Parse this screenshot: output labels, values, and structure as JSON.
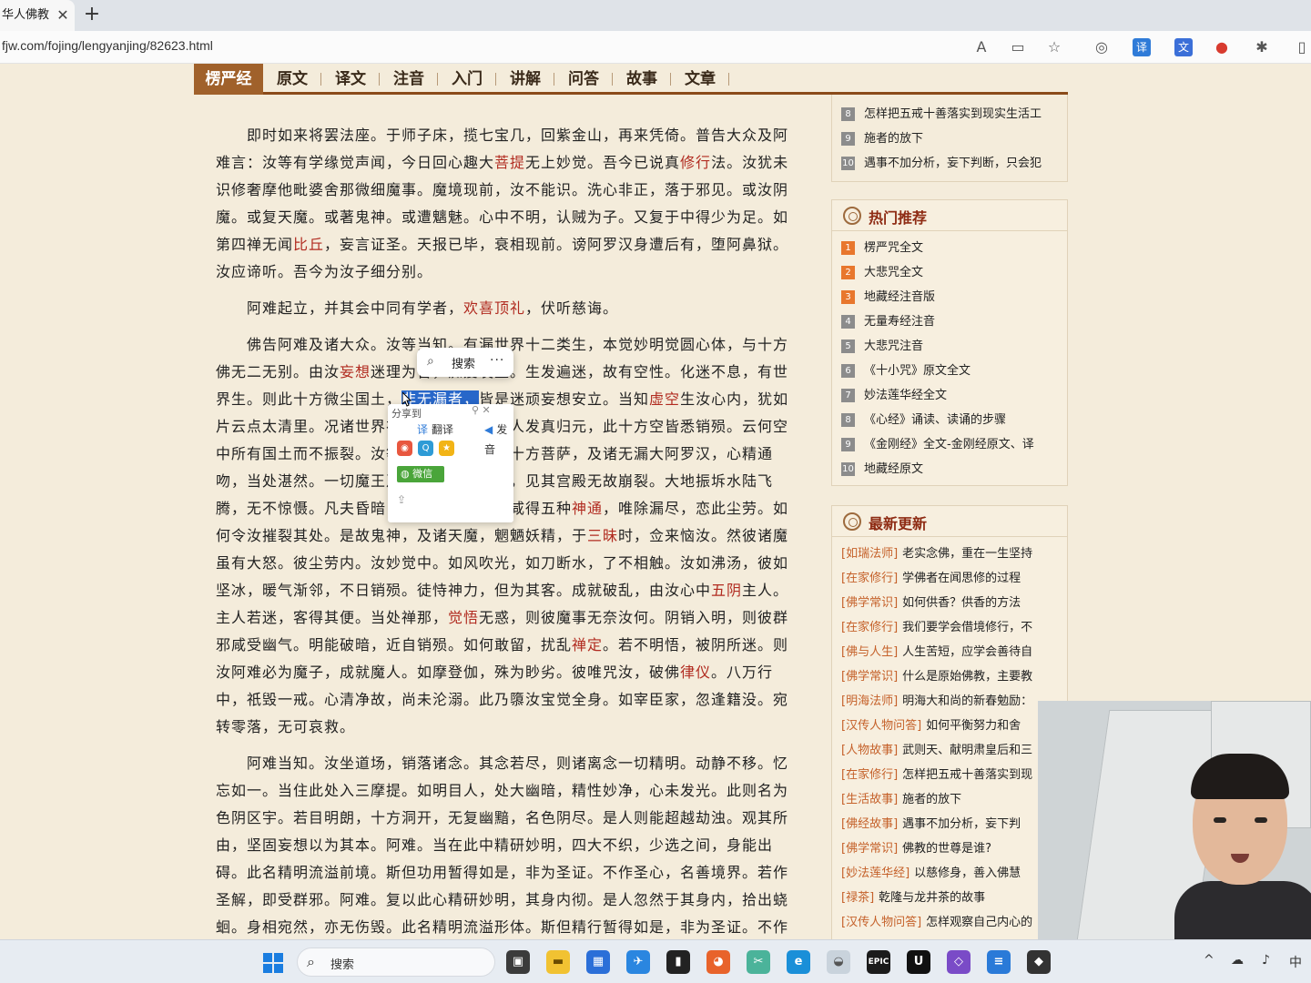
{
  "browser": {
    "tab_title": "华人佛教",
    "url": "fjw.com/fojing/lengyanjing/82623.html",
    "new_tab": "+",
    "close": "✕"
  },
  "nav": {
    "brand": "楞严经",
    "items": [
      "原文",
      "译文",
      "注音",
      "入门",
      "讲解",
      "问答",
      "故事",
      "文章"
    ]
  },
  "article": {
    "p1": [
      "即时如来将罢法座。于师子床，揽七宝几，回紫金山，再来凭倚。普告大众及阿难言：汝等有学缘觉声闻，今日回心趣大",
      "菩提",
      "无上妙觉。吾今已说真",
      "修行",
      "法。汝犹未识修奢摩他毗婆舍那微细魔事。魔境现前，汝不能识。洗心非正，落于邪见。或汝阴魔。或复天魔。或著鬼神。或遭魑魅。心中不明，认贼为子。又复于中得少为足。如第四禅无闻",
      "比丘",
      "，妄言证圣。天报已毕，衰相现前。谤阿罗汉身遭后有，堕阿鼻狱。汝应谛听。吾今为汝子细分别。"
    ],
    "p2": [
      "阿难起立，并其会中同有学者，",
      "欢喜顶礼",
      "，伏听慈诲。"
    ],
    "p3": [
      "佛告阿难及诸大众。汝等当知。有漏世界十二类生，本觉妙明觉圆心体，与十方佛无二无别。由汝",
      "妄想",
      "迷理为咎，痴爱发生。生发遍迷，故有空性。化迷不息，有世界生。则此十方微尘国土，",
      "非无漏者，",
      "皆是迷顽妄想安立。当知",
      "虚空",
      "生汝心内，犹如片云点太清里。况诸世界在虚空耶。汝等一人发真归元，此十方空皆悉销殒。云何空中所有国土而不振裂。汝等禅修饰三摩地，十方菩萨，及诸无漏大阿罗汉，心精通吻，当处湛然。一切魔王及与鬼神诸凡夫天，见其宫殿无故崩裂。大地振坼水陆飞腾，无不惊慑。凡夫昏暗，不觉迁讹。彼等咸得五种",
      "神通",
      "，唯除漏尽，恋此尘劳。如何令汝摧裂其处。是故鬼神，及诸天魔，魍魉妖精，于",
      "三昧",
      "时，佥来恼汝。然彼诸魔虽有大怒。彼尘劳内。汝妙觉中。如风吹光，如刀断水，了不相触。汝如沸汤，彼如坚冰，暖气渐邻，不日销殒。徒恃神力，但为其客。成就破乱，由汝心中",
      "五阴",
      "主人。主人若迷，客得其便。当处禅那，",
      "觉悟",
      "无惑，则彼魔事无奈汝何。阴销入明，则彼群邪咸受幽气。明能破暗，近自销殒。如何敢留，扰乱",
      "禅定",
      "。若不明悟，被阴所迷。则汝阿难必为魔子，成就魔人。如摩登伽，殊为眇劣。彼唯咒汝，破佛",
      "律仪",
      "。八万行中，祇毁一戒。心清净故，尚未沦溺。此乃隳汝宝觉全身。如宰臣家，忽逢籍没。宛转零落，无可哀救。"
    ],
    "p4": "阿难当知。汝坐道场，销落诸念。其念若尽，则诸离念一切精明。动静不移。忆忘如一。当住此处入三摩提。如明目人，处大幽暗，精性妙净，心未发光。此则名为色阴区宇。若目明朗，十方洞开，无复幽黯，名色阴尽。是人则能超越劫浊。观其所由，坚固妄想以为其本。阿难。当在此中精研妙明，四大不织，少选之间，身能出碍。此名精明流溢前境。斯但功用暂得如是，非为圣证。不作圣心，名善境界。若作圣解，即受群邪。阿难。复以此心精研妙明，其身内彻。是人忽然于其身内，拾出蛲蛔。身相宛然，亦无伤毁。此名精明流溢形体。斯但精行暂得如是，非为圣证。不作"
  },
  "sidebar": {
    "top_list": [
      {
        "n": "8",
        "text": "怎样把五戒十善落实到现实生活工"
      },
      {
        "n": "9",
        "text": "施者的放下"
      },
      {
        "n": "10",
        "text": "遇事不加分析，妄下判断，只会犯"
      }
    ],
    "hot": {
      "title": "热门推荐",
      "items": [
        {
          "n": "1",
          "text": "楞严咒全文"
        },
        {
          "n": "2",
          "text": "大悲咒全文"
        },
        {
          "n": "3",
          "text": "地藏经注音版"
        },
        {
          "n": "4",
          "text": "无量寿经注音"
        },
        {
          "n": "5",
          "text": "大悲咒注音"
        },
        {
          "n": "6",
          "text": "《十小咒》原文全文"
        },
        {
          "n": "7",
          "text": "妙法莲华经全文"
        },
        {
          "n": "8",
          "text": "《心经》诵读、读诵的步骤"
        },
        {
          "n": "9",
          "text": "《金刚经》全文-金刚经原文、译"
        },
        {
          "n": "10",
          "text": "地藏经原文"
        }
      ]
    },
    "latest": {
      "title": "最新更新",
      "items": [
        {
          "cat": "[如瑞法师]",
          "text": "老实念佛，重在一生坚持"
        },
        {
          "cat": "[在家修行]",
          "text": "学佛者在闻思修的过程"
        },
        {
          "cat": "[佛学常识]",
          "text": "如何供香？供香的方法"
        },
        {
          "cat": "[在家修行]",
          "text": "我们要学会借境修行，不"
        },
        {
          "cat": "[佛与人生]",
          "text": "人生苦短，应学会善待自"
        },
        {
          "cat": "[佛学常识]",
          "text": "什么是原始佛教，主要教"
        },
        {
          "cat": "[明海法师]",
          "text": "明海大和尚的新春勉励："
        },
        {
          "cat": "[汉传人物问答]",
          "text": "如何平衡努力和舍"
        },
        {
          "cat": "[人物故事]",
          "text": "武则天、献明肃皇后和三"
        },
        {
          "cat": "[在家修行]",
          "text": "怎样把五戒十善落实到现"
        },
        {
          "cat": "[生活故事]",
          "text": "施者的放下"
        },
        {
          "cat": "[佛经故事]",
          "text": "遇事不加分析，妄下判"
        },
        {
          "cat": "[佛学常识]",
          "text": "佛教的世尊是谁?"
        },
        {
          "cat": "[妙法莲华经]",
          "text": "以慈修身，善入佛慧"
        },
        {
          "cat": "[禄茶]",
          "text": "乾隆与龙井茶的故事"
        },
        {
          "cat": "[汉传人物问答]",
          "text": "怎样观察自己内心的"
        }
      ]
    }
  },
  "popup": {
    "search": "搜索",
    "more": "···",
    "share_label": "分享到",
    "translate": "翻译",
    "speak": "发音",
    "wechat": "微信"
  },
  "taskbar": {
    "search_placeholder": "搜索",
    "ime": "中",
    "epic": "EPIC"
  },
  "colors": {
    "nav_brand_bg": "#a0612b",
    "keyword": "#b12b20",
    "selection": "#2867c9",
    "category": "#c5612a"
  }
}
